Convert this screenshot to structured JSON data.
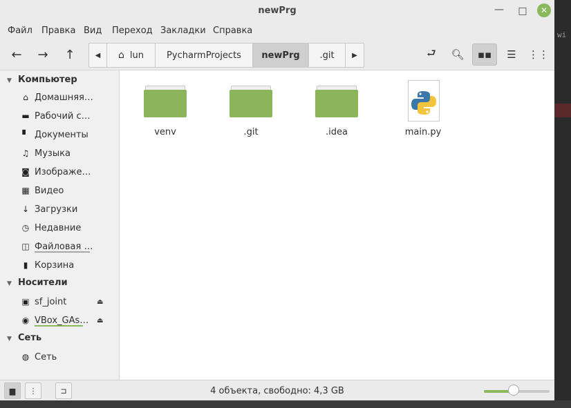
{
  "window": {
    "title": "newPrg",
    "minimize_label": "—",
    "maximize_label": "□",
    "close_label": "✕"
  },
  "menu": [
    "Файл",
    "Правка",
    "Вид",
    "Переход",
    "Закладки",
    "Справка"
  ],
  "path": {
    "home_label": "lun",
    "segments": [
      "PycharmProjects",
      "newPrg",
      ".git"
    ],
    "active_index": 1
  },
  "sidebar": {
    "sections": [
      {
        "title": "Компьютер",
        "items": [
          {
            "label": "Домашняя…",
            "icon": "home-icon"
          },
          {
            "label": "Рабочий с…",
            "icon": "desktop-icon"
          },
          {
            "label": "Документы",
            "icon": "document-icon"
          },
          {
            "label": "Музыка",
            "icon": "music-icon"
          },
          {
            "label": "Изображе…",
            "icon": "camera-icon"
          },
          {
            "label": "Видео",
            "icon": "film-icon"
          },
          {
            "label": "Загрузки",
            "icon": "download-icon"
          },
          {
            "label": "Недавние",
            "icon": "clock-icon"
          },
          {
            "label": "Файловая …",
            "icon": "filesystem-icon"
          },
          {
            "label": "Корзина",
            "icon": "trash-icon"
          }
        ]
      },
      {
        "title": "Носители",
        "items": [
          {
            "label": "sf_joint",
            "icon": "drive-icon",
            "eject": true
          },
          {
            "label": "VBox_GAs…",
            "icon": "disc-icon",
            "eject": true
          }
        ]
      },
      {
        "title": "Сеть",
        "items": [
          {
            "label": "Сеть",
            "icon": "network-icon"
          }
        ]
      }
    ]
  },
  "files": [
    {
      "name": "venv",
      "type": "folder"
    },
    {
      "name": ".git",
      "type": "folder"
    },
    {
      "name": ".idea",
      "type": "folder"
    },
    {
      "name": "main.py",
      "type": "python"
    }
  ],
  "status": {
    "text": "4 объекта, свободно: 4,3 GB",
    "zoom_level": 0.45
  },
  "colors": {
    "accent": "#8ab85c",
    "folder": "#8ab55a"
  },
  "background": {
    "ide_fragment": "wi"
  }
}
